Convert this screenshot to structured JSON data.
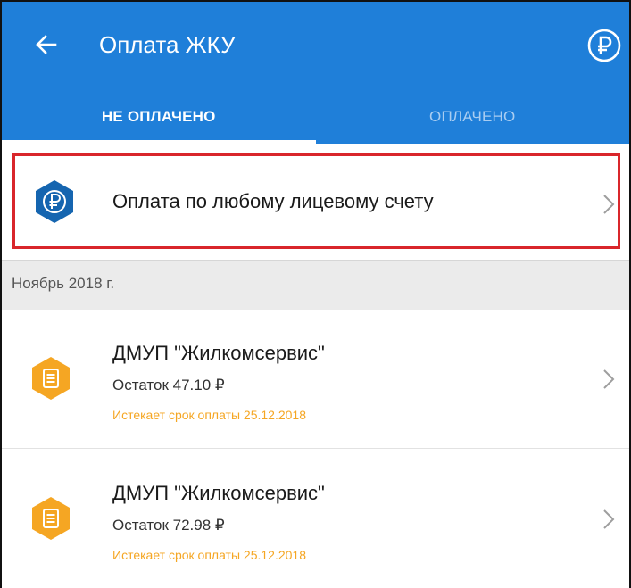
{
  "header": {
    "title": "Оплата ЖКУ",
    "back_icon": "arrow-left-icon",
    "action_icon": "ruble-circle-icon"
  },
  "tabs": [
    {
      "label": "НЕ ОПЛАЧЕНО",
      "active": true
    },
    {
      "label": "ОПЛАЧЕНО",
      "active": false
    }
  ],
  "any_account": {
    "label": "Оплата по любому лицевому счету",
    "icon": "ruble-hexagon-icon",
    "icon_color": "#1565b0"
  },
  "section": {
    "title": "Ноябрь 2018 г."
  },
  "bills": [
    {
      "provider": "ДМУП \"Жилкомсервис\"",
      "remainder": "Остаток 47.10 ₽",
      "due": "Истекает срок оплаты 25.12.2018",
      "icon": "document-hexagon-icon"
    },
    {
      "provider": "ДМУП \"Жилкомсервис\"",
      "remainder": "Остаток 72.98 ₽",
      "due": "Истекает срок оплаты 25.12.2018",
      "icon": "document-hexagon-icon"
    }
  ],
  "colors": {
    "appbar": "#1f7fd9",
    "highlight_border": "#d9262b",
    "bill_icon": "#f5a623",
    "due_text": "#f5a623"
  }
}
